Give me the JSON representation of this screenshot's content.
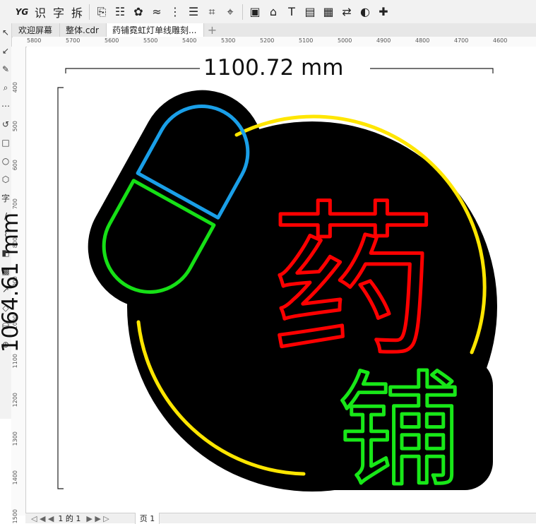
{
  "toolbar": {
    "items": [
      {
        "label": "YG",
        "icon": "yg-logo-icon"
      },
      {
        "label": "识",
        "icon": "recognize-icon"
      },
      {
        "label": "字",
        "icon": "text-icon"
      },
      {
        "label": "拆",
        "icon": "split-icon"
      },
      {
        "label": "⎘",
        "icon": "clipboard-icon"
      },
      {
        "label": "☷",
        "icon": "grid-icon"
      },
      {
        "label": "✿",
        "icon": "flower-icon"
      },
      {
        "label": "≈",
        "icon": "wave-icon"
      },
      {
        "label": "⋮",
        "icon": "nodes-icon"
      },
      {
        "label": "☰",
        "icon": "lines-icon"
      },
      {
        "label": "⌗",
        "icon": "hash-icon"
      },
      {
        "label": "⌖",
        "icon": "target-icon"
      },
      {
        "label": "▣",
        "icon": "layers-icon"
      },
      {
        "label": "⌂",
        "icon": "image-icon"
      },
      {
        "label": "T",
        "icon": "text-format-icon"
      },
      {
        "label": "▤",
        "icon": "list-icon"
      },
      {
        "label": "▦",
        "icon": "matrix-icon"
      },
      {
        "label": "⇄",
        "icon": "swap-icon"
      },
      {
        "label": "◐",
        "icon": "color-icon"
      },
      {
        "label": "✚",
        "icon": "puzzle-icon"
      }
    ]
  },
  "tabs": [
    {
      "label": "欢迎屏幕"
    },
    {
      "label": "整体.cdr"
    },
    {
      "label": "药铺霓虹灯单线雕刻..."
    }
  ],
  "tab_add": "+",
  "ruler": {
    "top_ticks": [
      "5800",
      "5700",
      "5600",
      "5500",
      "5400",
      "5300",
      "5200",
      "5100",
      "5000",
      "4900",
      "4800",
      "4700",
      "4600"
    ],
    "left_ticks": [
      "400",
      "500",
      "600",
      "700",
      "800",
      "900",
      "1000",
      "1100",
      "1200",
      "1300",
      "1400",
      "1500"
    ]
  },
  "toolbox": [
    "↖",
    "↙",
    "✎",
    "⌕",
    "⋯",
    "↺",
    "□",
    "○",
    "⬡",
    "字",
    "/",
    "⌇",
    "◧",
    "▩",
    "↗",
    "◇",
    "⛁",
    "⊕"
  ],
  "canvas": {
    "width_label": "1100.72 mm",
    "height_label": "1064.61 mm",
    "sign_text_1": "药",
    "sign_text_2": "铺",
    "colors": {
      "background": "#000000",
      "ring": "#ffe600",
      "capsule_top": "#1a9fe8",
      "capsule_bottom": "#16e016",
      "text_red": "#ff0000",
      "text_green": "#18e818"
    }
  },
  "status": {
    "nav": "◁ ◀ ◀",
    "page_label": "1 的 1",
    "nav_right": "▶ ▶ ▷",
    "page_tab": "页 1"
  }
}
